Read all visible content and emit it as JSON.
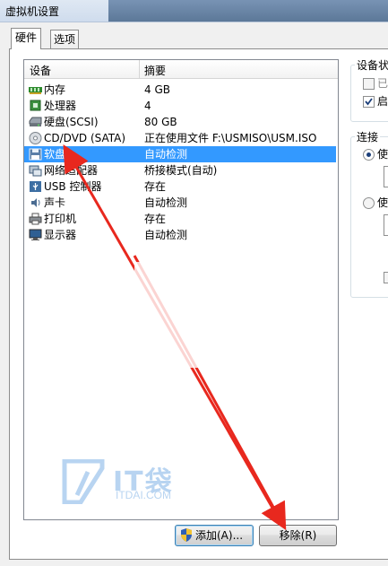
{
  "window": {
    "title": "虚拟机设置"
  },
  "tabs": [
    {
      "label": "硬件",
      "active": true
    },
    {
      "label": "选项",
      "active": false
    }
  ],
  "device_list": {
    "columns": [
      "设备",
      "摘要"
    ],
    "rows": [
      {
        "name": "内存",
        "summary": "4 GB",
        "icon": "memory-icon",
        "selected": false
      },
      {
        "name": "处理器",
        "summary": "4",
        "icon": "processor-icon",
        "selected": false
      },
      {
        "name": "硬盘(SCSI)",
        "summary": "80 GB",
        "icon": "harddisk-icon",
        "selected": false
      },
      {
        "name": "CD/DVD (SATA)",
        "summary": "正在使用文件 F:\\USMISO\\USM.ISO",
        "icon": "cd-dvd-icon",
        "selected": false
      },
      {
        "name": "软盘",
        "summary": "自动检测",
        "icon": "floppy-icon",
        "selected": true
      },
      {
        "name": "网络适配器",
        "summary": "桥接模式(自动)",
        "icon": "network-adapter-icon",
        "selected": false
      },
      {
        "name": "USB 控制器",
        "summary": "存在",
        "icon": "usb-icon",
        "selected": false
      },
      {
        "name": "声卡",
        "summary": "自动检测",
        "icon": "sound-card-icon",
        "selected": false
      },
      {
        "name": "打印机",
        "summary": "存在",
        "icon": "printer-icon",
        "selected": false
      },
      {
        "name": "显示器",
        "summary": "自动检测",
        "icon": "display-icon",
        "selected": false
      }
    ]
  },
  "buttons": {
    "add": "添加(A)...",
    "remove": "移除(R)"
  },
  "right_panel": {
    "device_status": {
      "title": "设备状",
      "option1": "已",
      "option2": "启"
    },
    "connection": {
      "title": "连接",
      "radio1": "使",
      "radio2": "使"
    }
  },
  "watermark": {
    "brand": "IT袋",
    "url": "ITDAI.COM"
  },
  "colors": {
    "selection": "#3399ff",
    "arrow": "#e8281e",
    "watermark": "#7fb2e6"
  }
}
